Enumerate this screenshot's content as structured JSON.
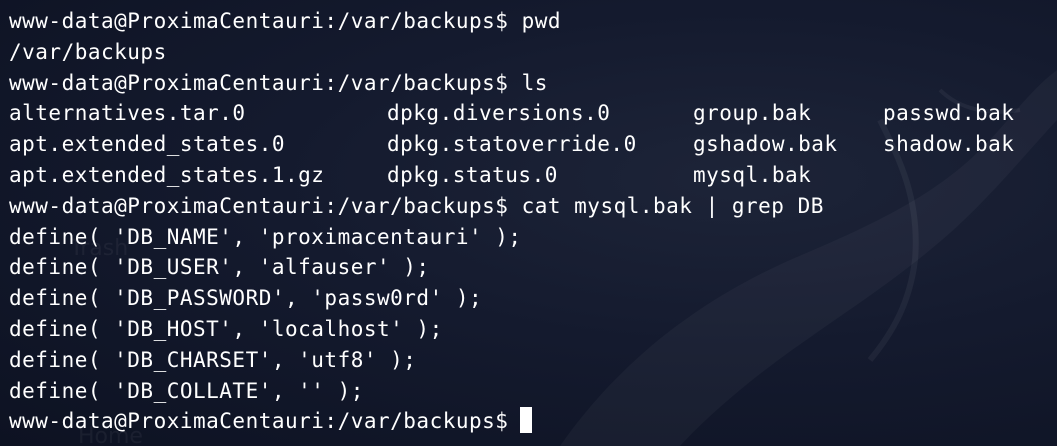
{
  "terminal": {
    "prompt": "www-data@ProximaCentauri:/var/backups$",
    "commands": {
      "pwd": "pwd",
      "ls": "ls",
      "cat": "cat mysql.bak | grep DB"
    },
    "pwd_output": "/var/backups",
    "ls_output": [
      [
        "alternatives.tar.0",
        "dpkg.diversions.0",
        "group.bak",
        "passwd.bak"
      ],
      [
        "apt.extended_states.0",
        "dpkg.statoverride.0",
        "gshadow.bak",
        "shadow.bak"
      ],
      [
        "apt.extended_states.1.gz",
        "dpkg.status.0",
        "mysql.bak",
        ""
      ]
    ],
    "grep_output": [
      "define( 'DB_NAME', 'proximacentauri' );",
      "define( 'DB_USER', 'alfauser' );",
      "define( 'DB_PASSWORD', 'passw0rd' );",
      "define( 'DB_HOST', 'localhost' );",
      "define( 'DB_CHARSET', 'utf8' );",
      "define( 'DB_COLLATE', '' );"
    ]
  },
  "colors": {
    "background": "#141a2e",
    "foreground": "#ffffff"
  },
  "background": {
    "faint_label_1": "Trash",
    "faint_label_2": "Home"
  }
}
